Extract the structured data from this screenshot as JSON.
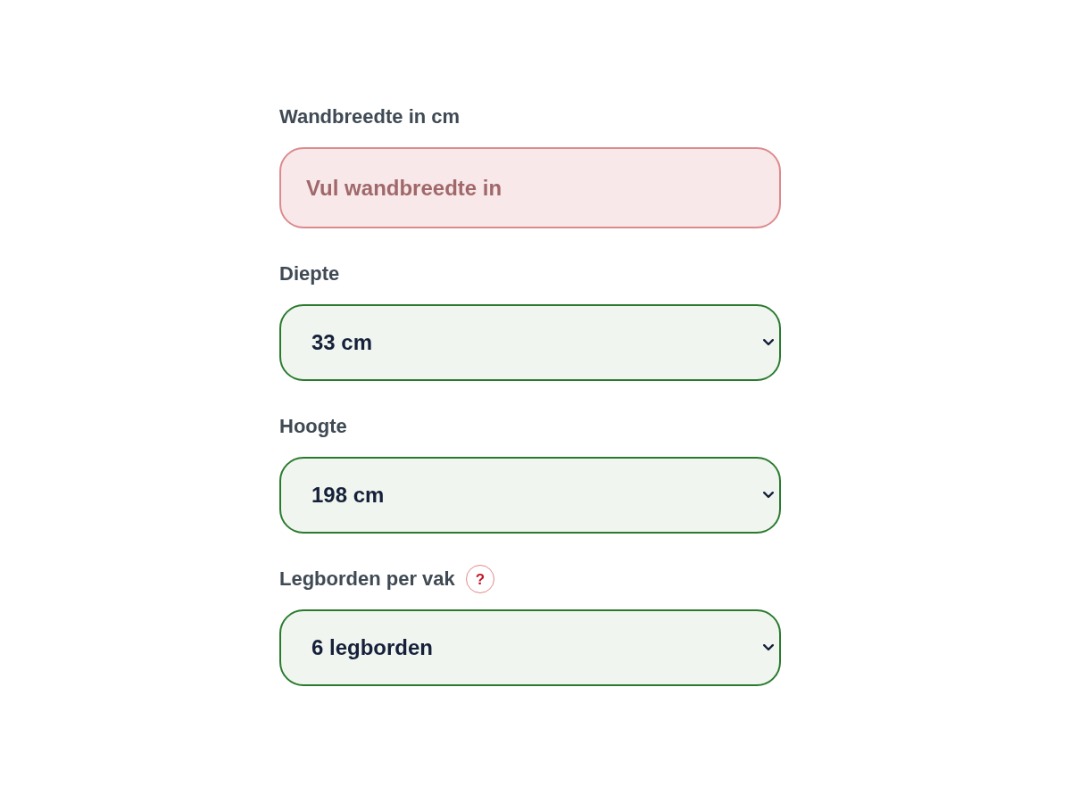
{
  "fields": [
    {
      "kind": "text",
      "label": "Wandbreedte in cm",
      "placeholder": "Vul wandbreedte in",
      "valid": false
    },
    {
      "kind": "select",
      "label": "Diepte",
      "value": "33 cm",
      "valid": true
    },
    {
      "kind": "select",
      "label": "Hoogte",
      "value": "198 cm",
      "valid": true
    },
    {
      "kind": "select",
      "label": "Legborden per vak",
      "help": "?",
      "value": "6 legborden",
      "valid": true
    }
  ]
}
